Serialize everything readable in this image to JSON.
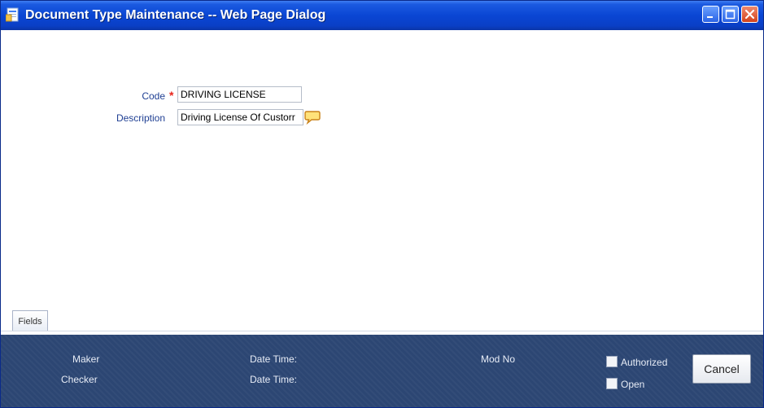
{
  "window": {
    "title": "Document Type Maintenance -- Web Page Dialog"
  },
  "form": {
    "code_label": "Code",
    "required_mark": "*",
    "code_value": "DRIVING LICENSE",
    "description_label": "Description",
    "description_value": "Driving License Of Custorr"
  },
  "tabs": [
    {
      "label": "Fields"
    }
  ],
  "footer": {
    "maker_label": "Maker",
    "checker_label": "Checker",
    "date_time_label_1": "Date Time:",
    "date_time_label_2": "Date Time:",
    "mod_no_label": "Mod No",
    "authorized_label": "Authorized",
    "open_label": "Open",
    "cancel_label": "Cancel"
  },
  "colors": {
    "title_bar": "#0a46d4",
    "footer_bg": "#2c4673",
    "label_blue": "#1f3f93",
    "required_red": "#e8241b"
  },
  "icons": {
    "title": "dialog-page-icon",
    "description_lookup": "speech-bubble-icon",
    "minimize": "minimize-icon",
    "maximize": "maximize-icon",
    "close": "close-icon"
  }
}
